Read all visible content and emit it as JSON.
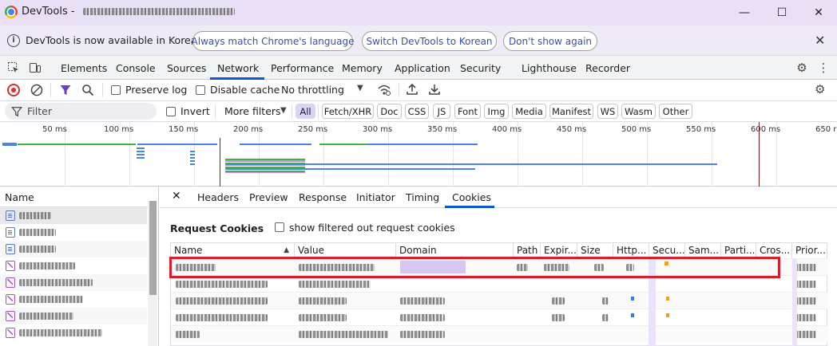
{
  "titlebar": {
    "app_name": "DevTools -",
    "minimize_glyph": "—",
    "maximize_glyph": "☐",
    "close_glyph": "✕"
  },
  "infobar": {
    "message": "DevTools is now available in Korean!",
    "buttons": [
      "Always match Chrome's language",
      "Switch DevTools to Korean",
      "Don't show again"
    ],
    "close_glyph": "✕"
  },
  "main_tabs": [
    "Elements",
    "Console",
    "Sources",
    "Network",
    "Performance",
    "Memory",
    "Application",
    "Security",
    "Lighthouse",
    "Recorder"
  ],
  "active_main_tab": "Network",
  "network_toolbar": {
    "preserve_log": "Preserve log",
    "disable_cache": "Disable cache",
    "throttling": "No throttling"
  },
  "filter_row": {
    "filter_placeholder": "Filter",
    "invert": "Invert",
    "more_filters": "More filters",
    "chips": [
      "All",
      "Fetch/XHR",
      "Doc",
      "CSS",
      "JS",
      "Font",
      "Img",
      "Media",
      "Manifest",
      "WS",
      "Wasm",
      "Other"
    ],
    "active_chip": "All"
  },
  "timeline": {
    "ticks": [
      "50 ms",
      "100 ms",
      "150 ms",
      "200 ms",
      "250 ms",
      "300 ms",
      "350 ms",
      "400 ms",
      "450 ms",
      "500 ms",
      "550 ms",
      "600 ms",
      "650 r"
    ]
  },
  "name_pane": {
    "header": "Name",
    "rows": [
      {
        "type": "doc"
      },
      {
        "type": "doc"
      },
      {
        "type": "doc"
      },
      {
        "type": "req"
      },
      {
        "type": "req"
      },
      {
        "type": "req"
      },
      {
        "type": "req"
      },
      {
        "type": "req"
      }
    ]
  },
  "detail": {
    "close_glyph": "✕",
    "tabs": [
      "Headers",
      "Preview",
      "Response",
      "Initiator",
      "Timing",
      "Cookies"
    ],
    "active_tab": "Cookies",
    "section_title": "Request Cookies",
    "show_filtered": "show filtered out request cookies",
    "columns": [
      "Name",
      "Value",
      "Domain",
      "Path",
      "Expir...",
      "Size",
      "Http...",
      "Secu...",
      "Sam...",
      "Parti...",
      "Cros...",
      "Prior..."
    ],
    "sorted_column": "Name",
    "sort_indicator": "▲",
    "highlight_color": "#e01b2a"
  },
  "colors": {
    "accent": "#0b57d0",
    "titlebar": "#e9e0f7",
    "infobar": "#eeeaf6",
    "active_chip": "#d9d3f5"
  }
}
